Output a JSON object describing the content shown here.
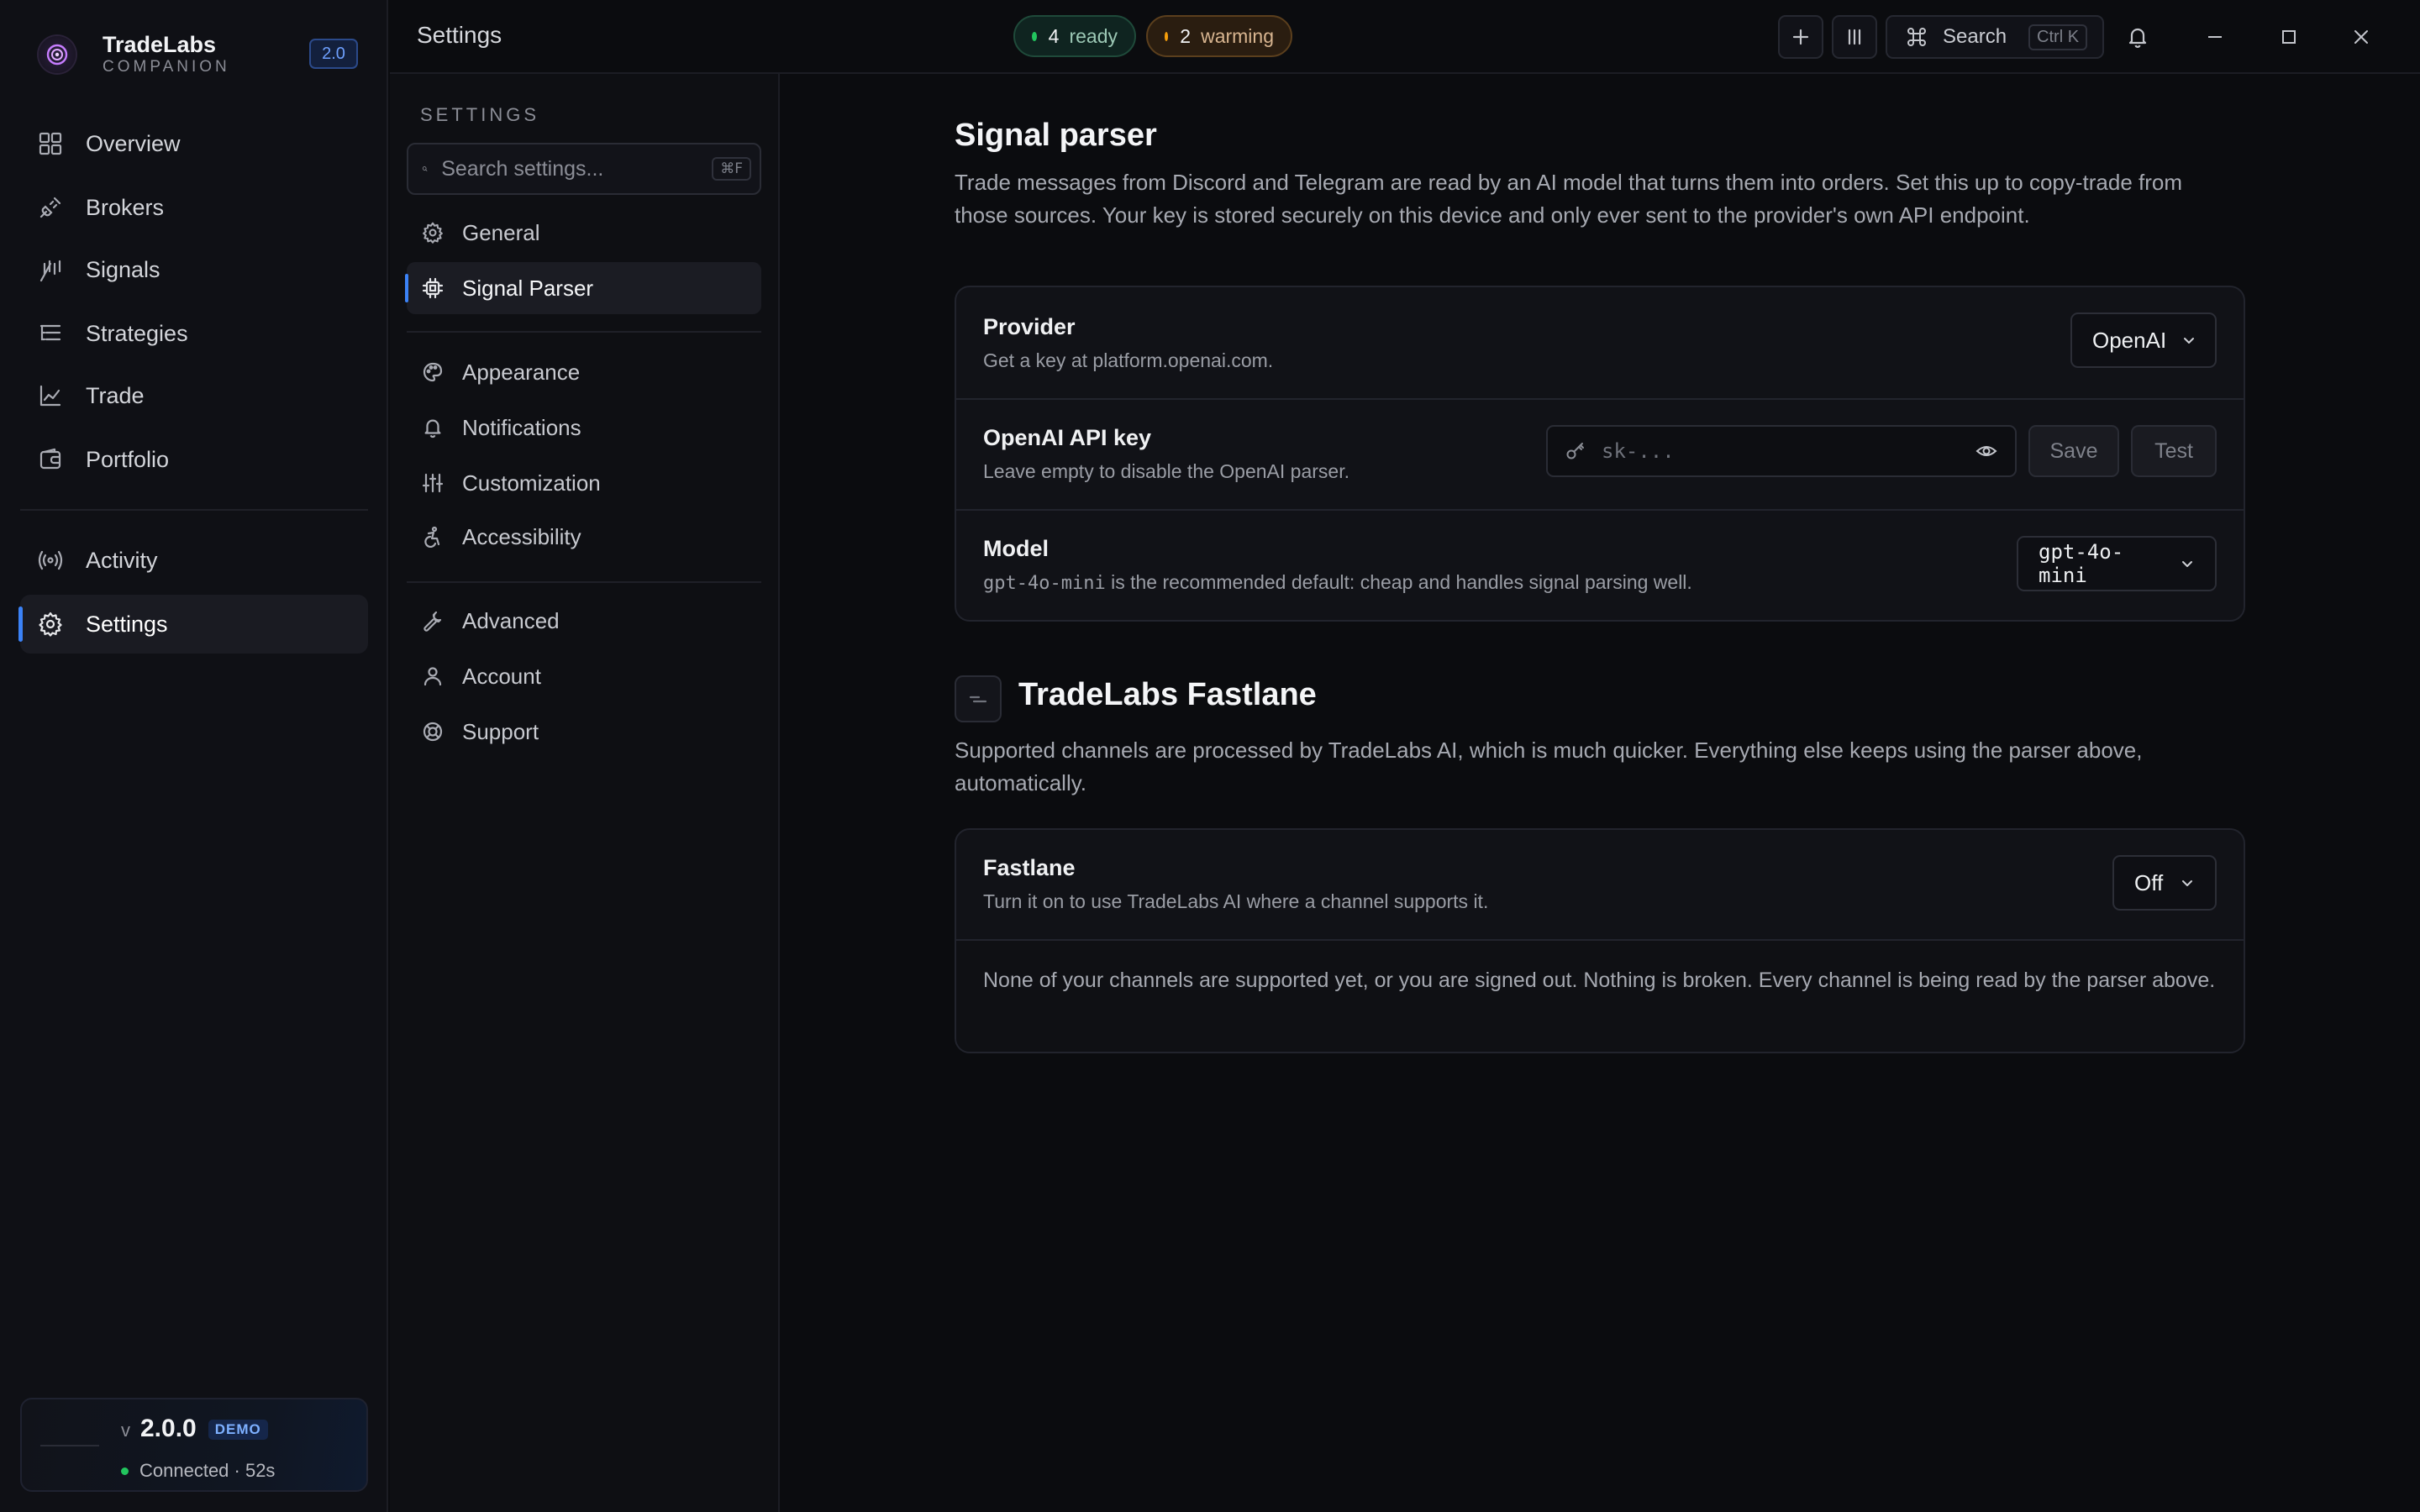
{
  "app": {
    "name": "TradeLabs",
    "subtitle": "COMPANION",
    "version_badge": "2.0",
    "nav_primary": [
      {
        "label": "Overview",
        "icon": "grid-icon"
      },
      {
        "label": "Brokers",
        "icon": "plug-icon"
      },
      {
        "label": "Signals",
        "icon": "antenna-icon"
      },
      {
        "label": "Strategies",
        "icon": "list-tree-icon"
      },
      {
        "label": "Trade",
        "icon": "chart-line-icon"
      },
      {
        "label": "Portfolio",
        "icon": "wallet-icon"
      }
    ],
    "nav_secondary": [
      {
        "label": "Activity",
        "icon": "radio-waves-icon"
      },
      {
        "label": "Settings",
        "icon": "gear-icon",
        "active": true
      }
    ],
    "status": {
      "v_prefix": "v",
      "version": "2.0.0",
      "badge": "DEMO",
      "connection": "Connected · 52s"
    }
  },
  "topbar": {
    "title": "Settings",
    "ready": {
      "count": "4",
      "label": "ready",
      "color": "#22c55e"
    },
    "warming": {
      "count": "2",
      "label": "warming",
      "color": "#f59e0b"
    },
    "search_label": "Search",
    "search_shortcut": "Ctrl K"
  },
  "settings_nav": {
    "heading": "SETTINGS",
    "search_placeholder": "Search settings...",
    "search_shortcut": "⌘F",
    "groups": [
      [
        {
          "label": "General",
          "icon": "gear-icon"
        },
        {
          "label": "Signal Parser",
          "icon": "cpu-icon",
          "active": true
        }
      ],
      [
        {
          "label": "Appearance",
          "icon": "palette-icon"
        },
        {
          "label": "Notifications",
          "icon": "bell-icon"
        },
        {
          "label": "Customization",
          "icon": "sliders-icon"
        },
        {
          "label": "Accessibility",
          "icon": "accessibility-icon"
        }
      ],
      [
        {
          "label": "Advanced",
          "icon": "wrench-icon"
        },
        {
          "label": "Account",
          "icon": "user-icon"
        },
        {
          "label": "Support",
          "icon": "lifebuoy-icon"
        }
      ]
    ]
  },
  "signal_parser": {
    "title": "Signal parser",
    "description": "Trade messages from Discord and Telegram are read by an AI model that turns them into orders. Set this up to copy-trade from those sources. Your key is stored securely on this device and only ever sent to the provider's own API endpoint.",
    "provider": {
      "label": "Provider",
      "help": "Get a key at platform.openai.com.",
      "value": "OpenAI"
    },
    "api_key": {
      "label": "OpenAI API key",
      "help": "Leave empty to disable the OpenAI parser.",
      "placeholder": "sk-...",
      "value": "",
      "save_label": "Save",
      "test_label": "Test"
    },
    "model": {
      "label": "Model",
      "help_code": "gpt-4o-mini",
      "help_rest": " is the recommended default: cheap and handles signal parsing well.",
      "value": "gpt-4o-mini"
    }
  },
  "fastlane": {
    "title": "TradeLabs Fastlane",
    "description": "Supported channels are processed by TradeLabs AI, which is much quicker. Everything else keeps using the parser above, automatically.",
    "toggle": {
      "label": "Fastlane",
      "help": "Turn it on to use TradeLabs AI where a channel supports it.",
      "value": "Off"
    },
    "note": "None of your channels are supported yet, or you are signed out. Nothing is broken. Every channel is being read by the parser above."
  }
}
